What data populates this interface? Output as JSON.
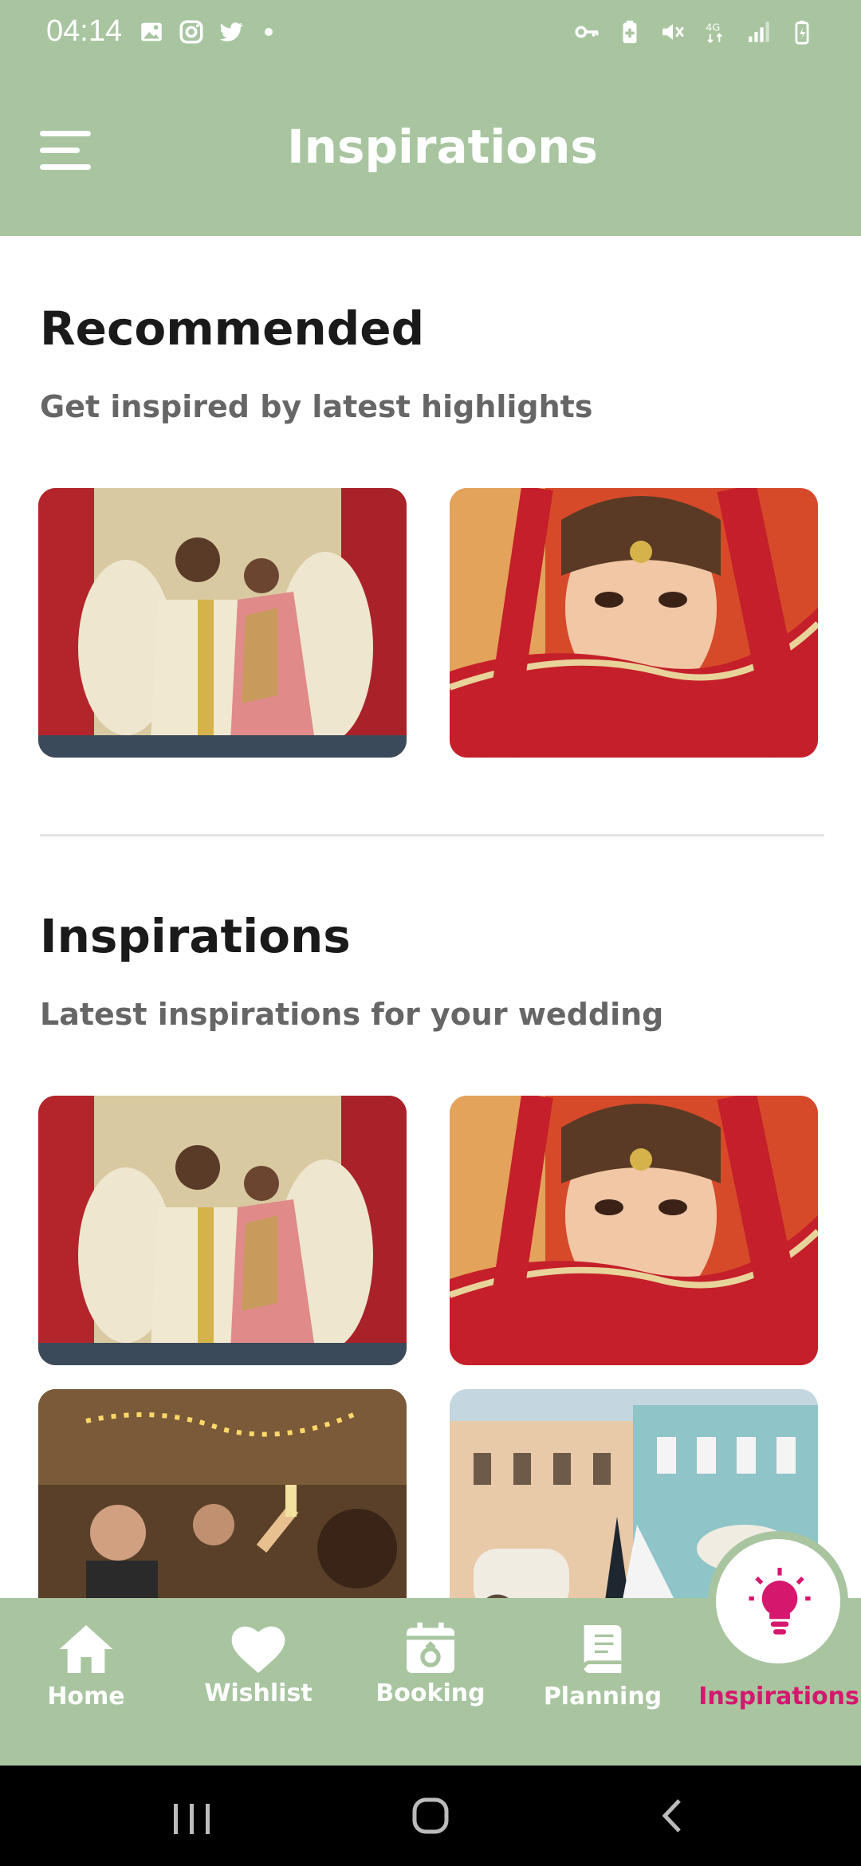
{
  "status_bar": {
    "time": "04:14",
    "left_icons": [
      "gallery-icon",
      "instagram-icon",
      "twitter-icon",
      "dot-icon"
    ],
    "right_icons": [
      "vpn-key-icon",
      "battery-saver-icon",
      "mute-icon",
      "network-4g-icon",
      "signal-icon",
      "battery-icon"
    ]
  },
  "header": {
    "title": "Inspirations",
    "menu_icon": "hamburger-icon"
  },
  "recommended": {
    "title": "Recommended",
    "subtitle": "Get inspired by latest highlights",
    "images": [
      "couple-photo",
      "bride-photo"
    ]
  },
  "inspirations": {
    "title": "Inspirations",
    "subtitle": "Latest inspirations for your wedding",
    "images": [
      "couple-photo",
      "bride-photo",
      "party-photo",
      "street-wedding-photo"
    ]
  },
  "bottom_nav": {
    "items": [
      {
        "label": "Home",
        "icon": "home-icon"
      },
      {
        "label": "Wishlist",
        "icon": "heart-icon"
      },
      {
        "label": "Booking",
        "icon": "booking-icon"
      },
      {
        "label": "Planning",
        "icon": "book-icon"
      },
      {
        "label": "Inspirations",
        "icon": "lightbulb-icon",
        "active": true
      }
    ]
  },
  "colors": {
    "header_bg": "#a8c5a0",
    "accent": "#d6176e",
    "subtitle": "#666666"
  },
  "system_nav": [
    "recents-icon",
    "home-circle-icon",
    "back-icon"
  ]
}
